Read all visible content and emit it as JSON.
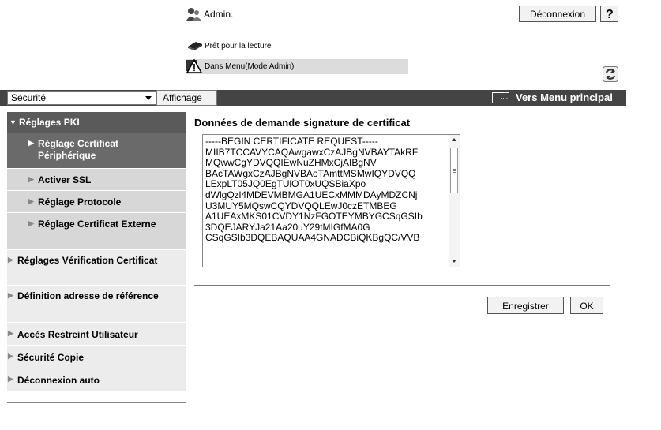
{
  "header": {
    "admin_label": "Admin.",
    "logout_label": "Déconnexion",
    "help_label": "?",
    "status_ready": "Prêt pour la lecture",
    "status_mode": "Dans Menu(Mode Admin)"
  },
  "topbar": {
    "category_select": "Sécurité",
    "tab_label": "Affichage",
    "main_menu_label": "Vers Menu principal"
  },
  "sidebar": {
    "items": [
      {
        "label": "Réglages PKI"
      },
      {
        "label": "Réglage Certificat Périphérique"
      },
      {
        "label": "Activer SSL"
      },
      {
        "label": "Réglage Protocole"
      },
      {
        "label": "Réglage Certificat Externe"
      },
      {
        "label": "Réglages Vérification Certificat"
      },
      {
        "label": "Définition adresse de référence"
      },
      {
        "label": "Accès Restreint Utilisateur"
      },
      {
        "label": "Sécurité Copie"
      },
      {
        "label": "Déconnexion auto"
      }
    ]
  },
  "main": {
    "title": "Données de demande signature de certificat",
    "csr_text": "-----BEGIN CERTIFICATE REQUEST-----\nMIIB7TCCAVYCAQAwgawxCzAJBgNVBAYTAkRF\nMQwwCgYDVQQIEwNuZHMxCjAIBgNV\nBAcTAWgxCzAJBgNVBAoTAmttMSMwIQYDVQQ\nLExpLT05JQ0EgTUlOT0xUQSBiaXpo\ndWlgQzl4MDEVMBMGA1UECxMMMDAyMDZCNj\nU3MUY5MQswCQYDVQQLEwJ0czETMBEG\nA1UEAxMKS01CVDY1NzFGOTEYMBYGCSqGSIb\n3DQEJARYJa21Aa20uY29tMIGfMA0G\nCSqGSIb3DQEBAQUAA4GNADCBiQKBgQC/VVB",
    "save_label": "Enregistrer",
    "ok_label": "OK"
  },
  "colors": {
    "topbar": "#444444",
    "sidebar_main": "#5a5a5a",
    "sidebar_sub": "#d7d7d7",
    "sidebar_top": "#ececec"
  }
}
